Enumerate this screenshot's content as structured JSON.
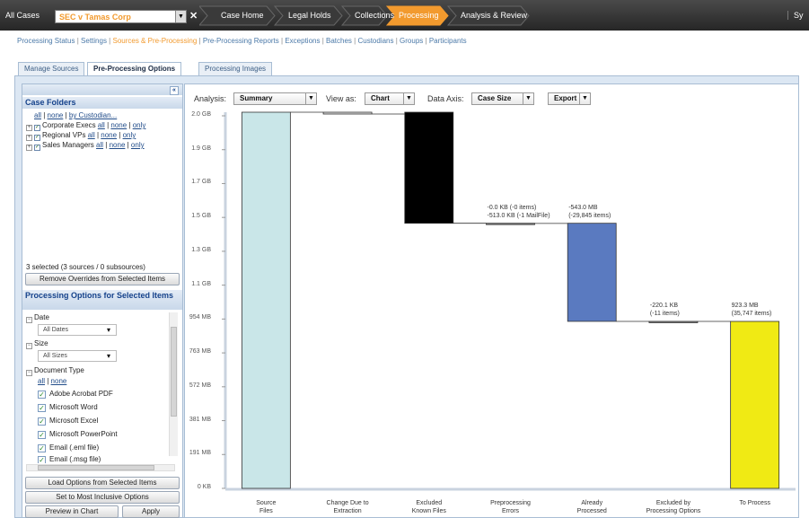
{
  "topbar": {
    "all_cases": "All Cases",
    "case_name": "SEC v Tamas Corp",
    "breadcrumbs": [
      "Case Home",
      "Legal Holds",
      "Collections",
      "Processing",
      "Analysis & Review"
    ],
    "active_crumb": "Processing",
    "right_text": "Sy"
  },
  "subnav": {
    "items": [
      "Processing Status",
      "Settings",
      "Sources & Pre-Processing",
      "Pre-Processing Reports",
      "Exceptions",
      "Batches",
      "Custodians",
      "Groups",
      "Participants"
    ],
    "active": "Sources & Pre-Processing"
  },
  "tabs": [
    "Manage Sources",
    "Pre-Processing Options",
    "Processing Images"
  ],
  "left": {
    "case_folders_title": "Case Folders",
    "top_links": [
      "all",
      "none",
      "by Custodian..."
    ],
    "folders": [
      {
        "name": "Corporate Execs"
      },
      {
        "name": "Regional VPs"
      },
      {
        "name": "Sales Managers"
      }
    ],
    "folder_links": [
      "all",
      "none",
      "only"
    ],
    "selected_text": "3 selected (3 sources / 0 subsources)",
    "remove_overrides": "Remove Overrides from Selected Items",
    "options_title": "Processing Options for Selected Items",
    "date_label": "Date",
    "date_value": "All Dates",
    "size_label": "Size",
    "size_value": "All Sizes",
    "doctype_label": "Document Type",
    "doctype_links": [
      "all",
      "none"
    ],
    "doctypes": [
      "Adobe Acrobat PDF",
      "Microsoft Word",
      "Microsoft Excel",
      "Microsoft PowerPoint",
      "Email (.eml file)",
      "Email (.msg file)"
    ],
    "load_options": "Load Options from Selected Items",
    "set_inclusive": "Set to Most Inclusive Options",
    "preview": "Preview in Chart",
    "apply": "Apply"
  },
  "controls": {
    "analysis_label": "Analysis:",
    "analysis_value": "Summary",
    "view_label": "View as:",
    "view_value": "Chart",
    "axis_label": "Data Axis:",
    "axis_value": "Case Size",
    "export_value": "Export"
  },
  "chart_data": {
    "type": "waterfall",
    "y_ticks": [
      "2.0 GB",
      "1.9 GB",
      "1.7 GB",
      "1.5 GB",
      "1.3 GB",
      "1.1 GB",
      "954 MB",
      "763 MB",
      "572 MB",
      "381 MB",
      "191 MB",
      "0 KB"
    ],
    "ylim_mb": [
      0,
      2080
    ],
    "categories": [
      "Source Files",
      "Change Due to Extraction",
      "Excluded Known Files",
      "Preprocessing Errors",
      "Already Processed",
      "Excluded by Processing Options",
      "To Process"
    ],
    "bars": [
      {
        "category": "Source Files",
        "start_mb": 0,
        "end_mb": 2080,
        "color": "#c9e6e8"
      },
      {
        "category": "Change Due to Extraction",
        "start_mb": 2070,
        "end_mb": 2080,
        "color": "#dddddd"
      },
      {
        "category": "Excluded Known Files",
        "start_mb": 1466,
        "end_mb": 2080,
        "color": "#000000"
      },
      {
        "category": "Preprocessing Errors",
        "start_mb": 1465,
        "end_mb": 1466,
        "color": "#888888"
      },
      {
        "category": "Already Processed",
        "start_mb": 923.5,
        "end_mb": 1466,
        "color": "#5a7ac0"
      },
      {
        "category": "Excluded by Processing Options",
        "start_mb": 923.3,
        "end_mb": 923.5,
        "color": "#888888"
      },
      {
        "category": "To Process",
        "start_mb": 0,
        "end_mb": 923.3,
        "color": "#f0ea14"
      }
    ],
    "annotations": [
      {
        "category": "Preprocessing Errors",
        "lines": [
          "-0.0 KB (-0 items)",
          "-513.0 KB (-1 MailFile)"
        ]
      },
      {
        "category": "Already Processed",
        "lines": [
          "-543.0 MB",
          "(-29,845 items)"
        ]
      },
      {
        "category": "Excluded by Processing Options",
        "lines": [
          "-220.1 KB",
          "(-11 items)"
        ]
      },
      {
        "category": "To Process",
        "lines": [
          "923.3 MB",
          "(35,747 items)"
        ]
      }
    ],
    "x_labels": [
      [
        "Source",
        "Files"
      ],
      [
        "Change Due to",
        "Extraction"
      ],
      [
        "Excluded",
        "Known Files"
      ],
      [
        "Preprocessing",
        "Errors"
      ],
      [
        "Already",
        "Processed"
      ],
      [
        "Excluded by",
        "Processing Options"
      ],
      [
        "To Process",
        ""
      ]
    ],
    "grid": false,
    "legend": "none"
  }
}
